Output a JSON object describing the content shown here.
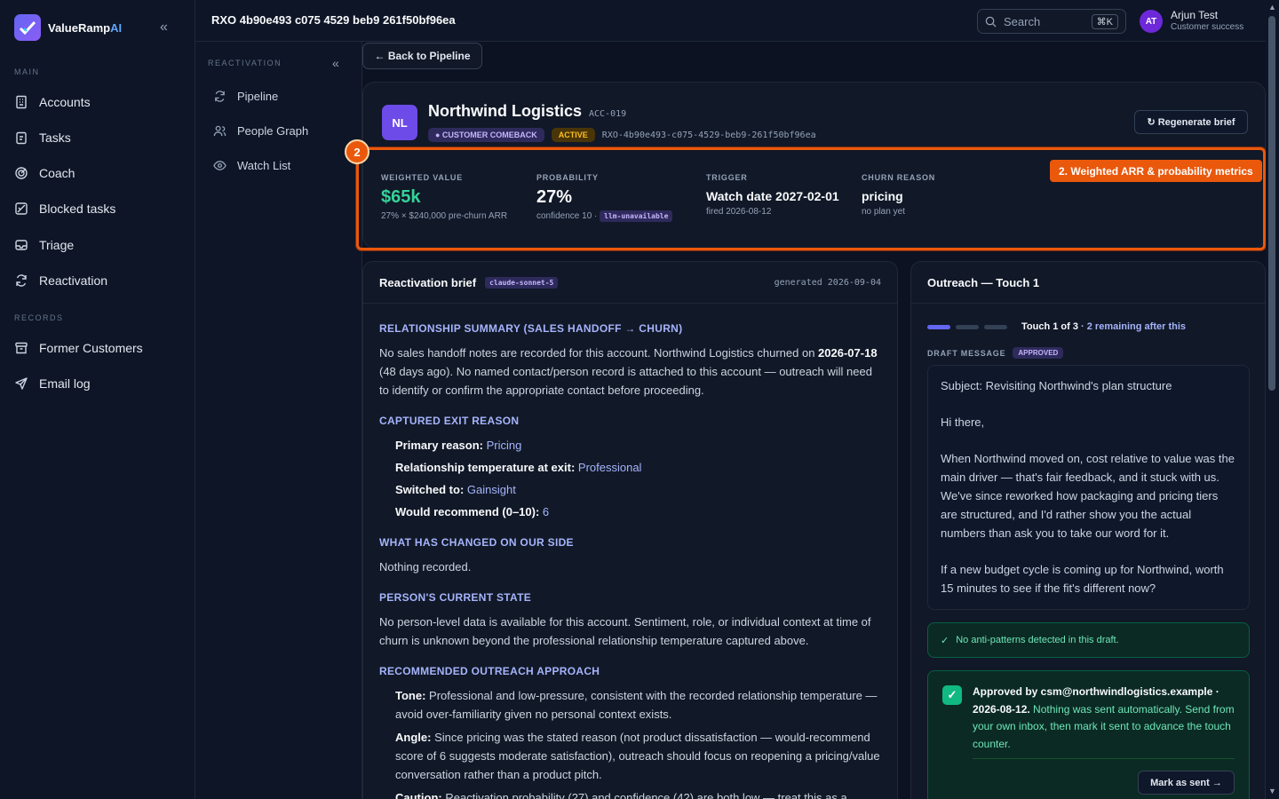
{
  "brand": {
    "name": "ValueRamp",
    "suffix": "AI"
  },
  "nav": {
    "main_label": "MAIN",
    "records_label": "RECORDS",
    "main": [
      {
        "label": "Accounts",
        "icon": "building-icon"
      },
      {
        "label": "Tasks",
        "icon": "clipboard-icon"
      },
      {
        "label": "Coach",
        "icon": "target-icon"
      },
      {
        "label": "Blocked tasks",
        "icon": "blocked-icon"
      },
      {
        "label": "Triage",
        "icon": "inbox-icon"
      },
      {
        "label": "Reactivation",
        "icon": "refresh-icon"
      }
    ],
    "records": [
      {
        "label": "Former Customers",
        "icon": "archive-icon"
      },
      {
        "label": "Email log",
        "icon": "send-icon"
      }
    ]
  },
  "subnav": {
    "label": "REACTIVATION",
    "items": [
      {
        "label": "Pipeline",
        "icon": "refresh-icon"
      },
      {
        "label": "People Graph",
        "icon": "people-icon"
      },
      {
        "label": "Watch List",
        "icon": "eye-icon"
      }
    ]
  },
  "topbar": {
    "title": "RXO 4b90e493 c075 4529 beb9 261f50bf96ea",
    "search_placeholder": "Search",
    "shortcut": "⌘K",
    "user_initials": "AT",
    "user_name": "Arjun Test",
    "user_role": "Customer success"
  },
  "back_label": "← Back to Pipeline",
  "account": {
    "initials": "NL",
    "name": "Northwind Logistics",
    "id": "ACC-019",
    "tag_comeback": "● CUSTOMER COMEBACK",
    "tag_status": "ACTIVE",
    "rxo": "RXO-4b90e493-c075-4529-beb9-261f50bf96ea",
    "regenerate": "↻ Regenerate brief"
  },
  "metrics": {
    "weighted": {
      "label": "WEIGHTED VALUE",
      "value": "$65k",
      "sub": "27% × $240,000 pre-churn ARR"
    },
    "probability": {
      "label": "PROBABILITY",
      "value": "27%",
      "sub": "confidence 10 ·",
      "pill": "llm-unavailable"
    },
    "trigger": {
      "label": "TRIGGER",
      "value": "Watch date 2027-02-01",
      "sub": "fired 2026-08-12"
    },
    "churn": {
      "label": "CHURN REASON",
      "value": "pricing",
      "sub": "no plan yet"
    },
    "callout": "2. Weighted ARR & probability metrics",
    "badge": "2"
  },
  "brief": {
    "title": "Reactivation brief",
    "model": "claude-sonnet-5",
    "generated": "generated 2026-09-04",
    "s1_h": "RELATIONSHIP SUMMARY (SALES HANDOFF → CHURN)",
    "s1_a": "No sales handoff notes are recorded for this account. Northwind Logistics churned on ",
    "s1_date": "2026-07-18",
    "s1_b": " (48 days ago). No named contact/person record is attached to this account — outreach will need to identify or confirm the appropriate contact before proceeding.",
    "s2_h": "CAPTURED EXIT REASON",
    "s2_items": [
      {
        "k": "Primary reason:",
        "v": "Pricing"
      },
      {
        "k": "Relationship temperature at exit:",
        "v": "Professional"
      },
      {
        "k": "Switched to:",
        "v": "Gainsight"
      },
      {
        "k": "Would recommend (0–10):",
        "v": "6"
      }
    ],
    "s3_h": "WHAT HAS CHANGED ON OUR SIDE",
    "s3_p": "Nothing recorded.",
    "s4_h": "PERSON'S CURRENT STATE",
    "s4_p": "No person-level data is available for this account. Sentiment, role, or individual context at time of churn is unknown beyond the professional relationship temperature captured above.",
    "s5_h": "RECOMMENDED OUTREACH APPROACH",
    "s5_items": [
      {
        "k": "Tone:",
        "v": "Professional and low-pressure, consistent with the recorded relationship temperature — avoid over-familiarity given no personal context exists."
      },
      {
        "k": "Angle:",
        "v": "Since pricing was the stated reason (not product dissatisfaction — would-recommend score of 6 suggests moderate satisfaction), outreach should focus on reopening a pricing/value conversation rather than a product pitch."
      },
      {
        "k": "Caution:",
        "v": "Reactivation probability (27) and confidence (42) are both low — treat this as a"
      }
    ]
  },
  "outreach": {
    "title": "Outreach — Touch 1",
    "progress": {
      "current": 1,
      "total": 3
    },
    "touch_label": "Touch 1 of 3",
    "remaining": "· 2 remaining after this",
    "draft_label": "DRAFT MESSAGE",
    "draft_status": "APPROVED",
    "subject": "Subject: Revisiting Northwind's plan structure",
    "greeting": "Hi there,",
    "body1": "When Northwind moved on, cost relative to value was the main driver — that's fair feedback, and it stuck with us. We've since reworked how packaging and pricing tiers are structured, and I'd rather show you the actual numbers than ask you to take our word for it.",
    "body2": "If a new budget cycle is coming up for Northwind, worth 15 minutes to see if the fit's different now?",
    "anti": "No anti-patterns detected in this draft.",
    "approved_by": "Approved by csm@northwindlogistics.example · 2026-08-12.",
    "approved_note": " Nothing was sent automatically. Send from your own inbox, then mark it sent to advance the touch counter.",
    "mark_sent": "Mark as sent →"
  }
}
